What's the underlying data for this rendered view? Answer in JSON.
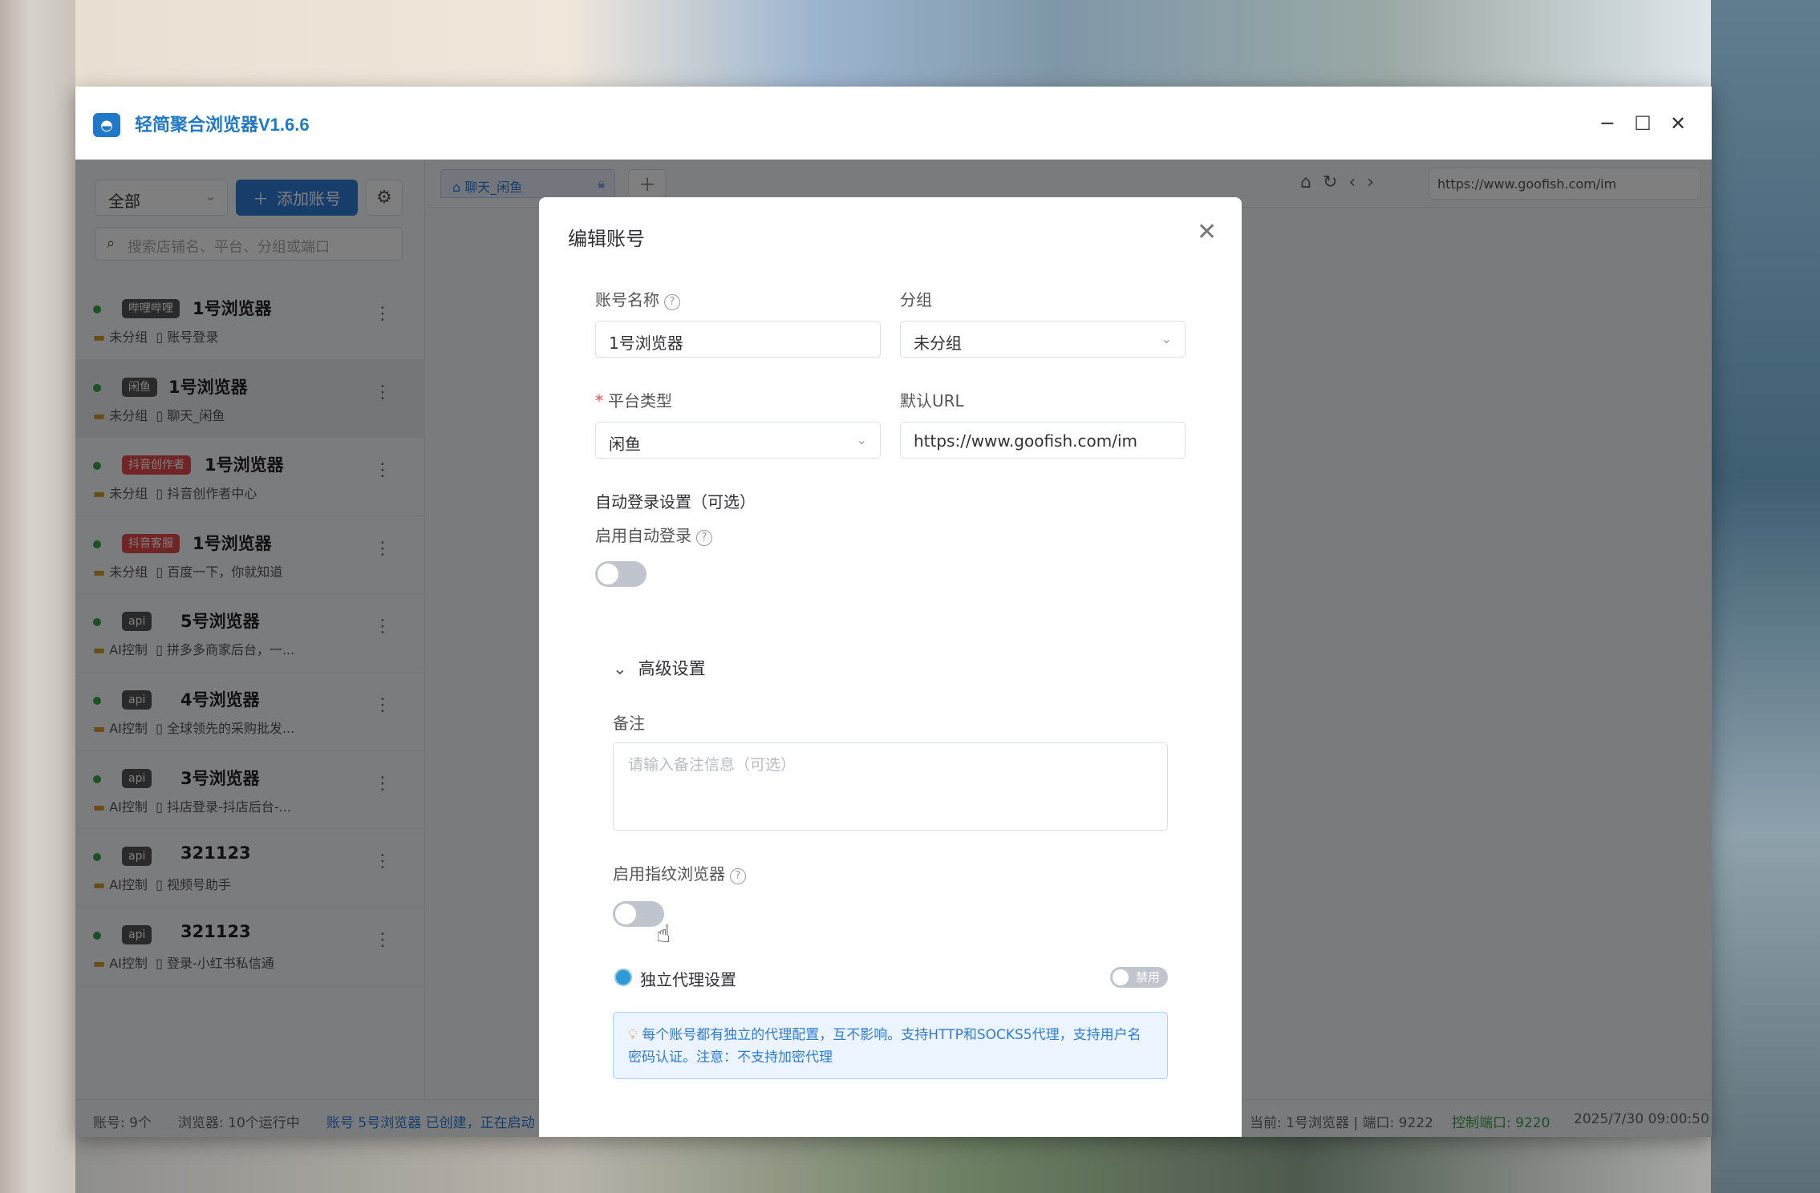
{
  "app": {
    "title": "轻简聚合浏览器V1.6.6",
    "window_controls": {
      "minimize": "─",
      "maximize": "☐",
      "close": "✕"
    }
  },
  "sidebar": {
    "filter_value": "全部",
    "add_account_label": "添加账号",
    "search_placeholder": "搜索店铺名、平台、分组或端口",
    "accounts": [
      {
        "tag": "哔哩哔哩",
        "tag_color": "#555555",
        "name": "1号浏览器",
        "group": "未分组",
        "page": "账号登录"
      },
      {
        "tag": "闲鱼",
        "tag_color": "#555555",
        "name": "1号浏览器",
        "group": "未分组",
        "page": "聊天_闲鱼",
        "active": true
      },
      {
        "tag": "抖音创作者",
        "tag_color": "#e24a4a",
        "name": "1号浏览器",
        "group": "未分组",
        "page": "抖音创作者中心"
      },
      {
        "tag": "抖音客服",
        "tag_color": "#e24a4a",
        "name": "1号浏览器",
        "group": "未分组",
        "page": "百度一下，你就知道"
      },
      {
        "tag": "api",
        "tag_color": "#555555",
        "name": "5号浏览器",
        "group": "AI控制",
        "page": "拼多多商家后台，一..."
      },
      {
        "tag": "api",
        "tag_color": "#555555",
        "name": "4号浏览器",
        "group": "AI控制",
        "page": "全球领先的采购批发..."
      },
      {
        "tag": "api",
        "tag_color": "#555555",
        "name": "3号浏览器",
        "group": "AI控制",
        "page": "抖店登录-抖店后台-..."
      },
      {
        "tag": "api",
        "tag_color": "#555555",
        "name": "321123",
        "group": "AI控制",
        "page": "视频号助手"
      },
      {
        "tag": "api",
        "tag_color": "#555555",
        "name": "321123",
        "group": "AI控制",
        "page": "登录-小红书私信通"
      }
    ]
  },
  "browser": {
    "tab_label": "聊天_闲鱼",
    "url": "https://www.goofish.com/im"
  },
  "statusbar": {
    "accounts": "账号: 9个",
    "browsers": "浏览器: 10个运行中",
    "message": "账号 5号浏览器 已创建，正在启动",
    "current": "当前: 1号浏览器 | 端口: 9222",
    "control_port": "控制端口: 9220",
    "datetime": "2025/7/30 09:00:50"
  },
  "dialog": {
    "title": "编辑账号",
    "account_name_label": "账号名称",
    "account_name_value": "1号浏览器",
    "group_label": "分组",
    "group_value": "未分组",
    "platform_label": "平台类型",
    "platform_value": "闲鱼",
    "default_url_label": "默认URL",
    "default_url_value": "https://www.goofish.com/im",
    "auto_login_section": "自动登录设置（可选）",
    "auto_login_label": "启用自动登录",
    "auto_login_enabled": false,
    "advanced_label": "高级设置",
    "remark_label": "备注",
    "remark_placeholder": "请输入备注信息（可选）",
    "fingerprint_label": "启用指纹浏览器",
    "fingerprint_enabled": false,
    "proxy_label": "独立代理设置",
    "proxy_toggle_text": "禁用",
    "proxy_tip": "每个账号都有独立的代理配置，互不影响。支持HTTP和SOCKS5代理，支持用户名密码认证。注意：不支持加密代理"
  }
}
